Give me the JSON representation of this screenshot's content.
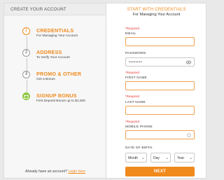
{
  "left": {
    "header": "CREATE YOUR ACCOUNT",
    "steps": [
      {
        "number": "1",
        "title": "CREDENTIALS",
        "subtitle": "For Managing Your Account"
      },
      {
        "number": "2",
        "title": "ADDRESS",
        "subtitle": "To Verify Your Account"
      },
      {
        "number": "3",
        "title": "PROMO & OTHER",
        "subtitle": "Get a Bonus"
      },
      {
        "number": "",
        "title": "SIGNUP BONUS",
        "subtitle": "First Deposit Bonus up to $1,000"
      }
    ],
    "already_text": "Already have an account?",
    "login_label": "Login here"
  },
  "form": {
    "title": "START WITH CREDENTIALS",
    "subtitle": "For Managing Your Account",
    "required_note": "*Required",
    "email_label": "EMAIL",
    "password_label": "PASSWORD",
    "password_value": "••••••••",
    "first_name_label": "FIRST NAME",
    "last_name_label": "LAST NAME",
    "mobile_label": "MOBILE PHONE",
    "dob_label": "DATE OF BIRTH",
    "month": "Month",
    "day": "Day",
    "year": "Year",
    "next_label": "NEXT"
  },
  "colors": {
    "accent": "#f08a1d",
    "success": "#8cc63f",
    "required": "#e53935"
  }
}
